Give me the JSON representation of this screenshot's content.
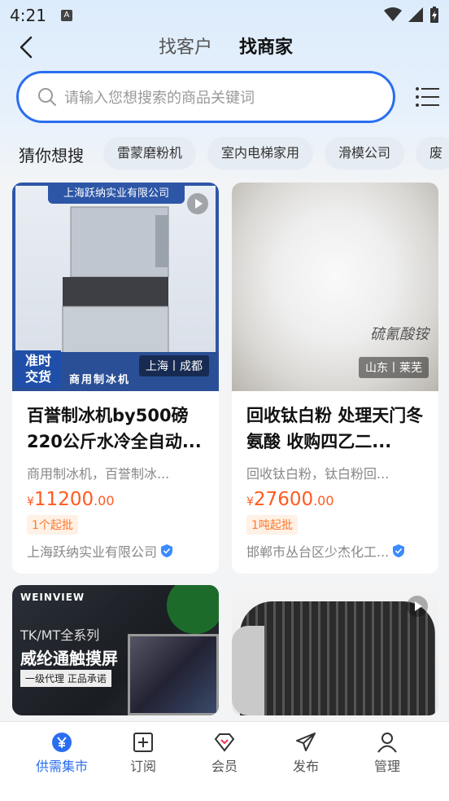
{
  "status": {
    "time": "4:21",
    "badge": "A"
  },
  "header": {
    "tabs": [
      {
        "label": "找客户",
        "active": false
      },
      {
        "label": "找商家",
        "active": true
      }
    ]
  },
  "search": {
    "placeholder": "请输入您想搜索的商品关键词"
  },
  "guess": {
    "title": "猜你想搜",
    "chips": [
      "雷蒙磨粉机",
      "室内电梯家用",
      "滑模公司",
      "废"
    ]
  },
  "products": [
    {
      "title": "百誉制冰机by500磅220公斤水冷全自动...",
      "desc": "商用制冰机，百誉制冰...",
      "price_symbol": "¥",
      "price_int": "11200",
      "price_dec": ".00",
      "min_order": "1个起批",
      "company": "上海跃纳实业有限公司",
      "location": "上海丨成都",
      "banner": "上海跃纳实业有限公司",
      "badge_line1": "准时",
      "badge_line2": "交货",
      "caption": "商用制冰机"
    },
    {
      "title": "回收钛白粉 处理天门冬氨酸 收购四乙二...",
      "desc": "回收钛白粉，钛白粉回...",
      "price_symbol": "¥",
      "price_int": "27600",
      "price_dec": ".00",
      "min_order": "1吨起批",
      "company": "邯郸市丛台区少杰化工...",
      "location": "山东丨莱芜",
      "signature": "硫氰酸铵"
    },
    {
      "brand": "WEINVIEW",
      "sub": "TK/MT全系列",
      "headline": "威纶通触摸屏",
      "tag": "一级代理 正品承诺"
    },
    {}
  ],
  "bottom_nav": [
    {
      "label": "供需集市",
      "icon": "yen-icon",
      "active": true
    },
    {
      "label": "订阅",
      "icon": "plus-square-icon",
      "active": false
    },
    {
      "label": "会员",
      "icon": "diamond-icon",
      "active": false
    },
    {
      "label": "发布",
      "icon": "paper-plane-icon",
      "active": false
    },
    {
      "label": "管理",
      "icon": "user-icon",
      "active": false
    }
  ],
  "colors": {
    "accent": "#2a6ef0",
    "price": "#ff5a1f",
    "min_tag_bg": "#fff1e6"
  }
}
